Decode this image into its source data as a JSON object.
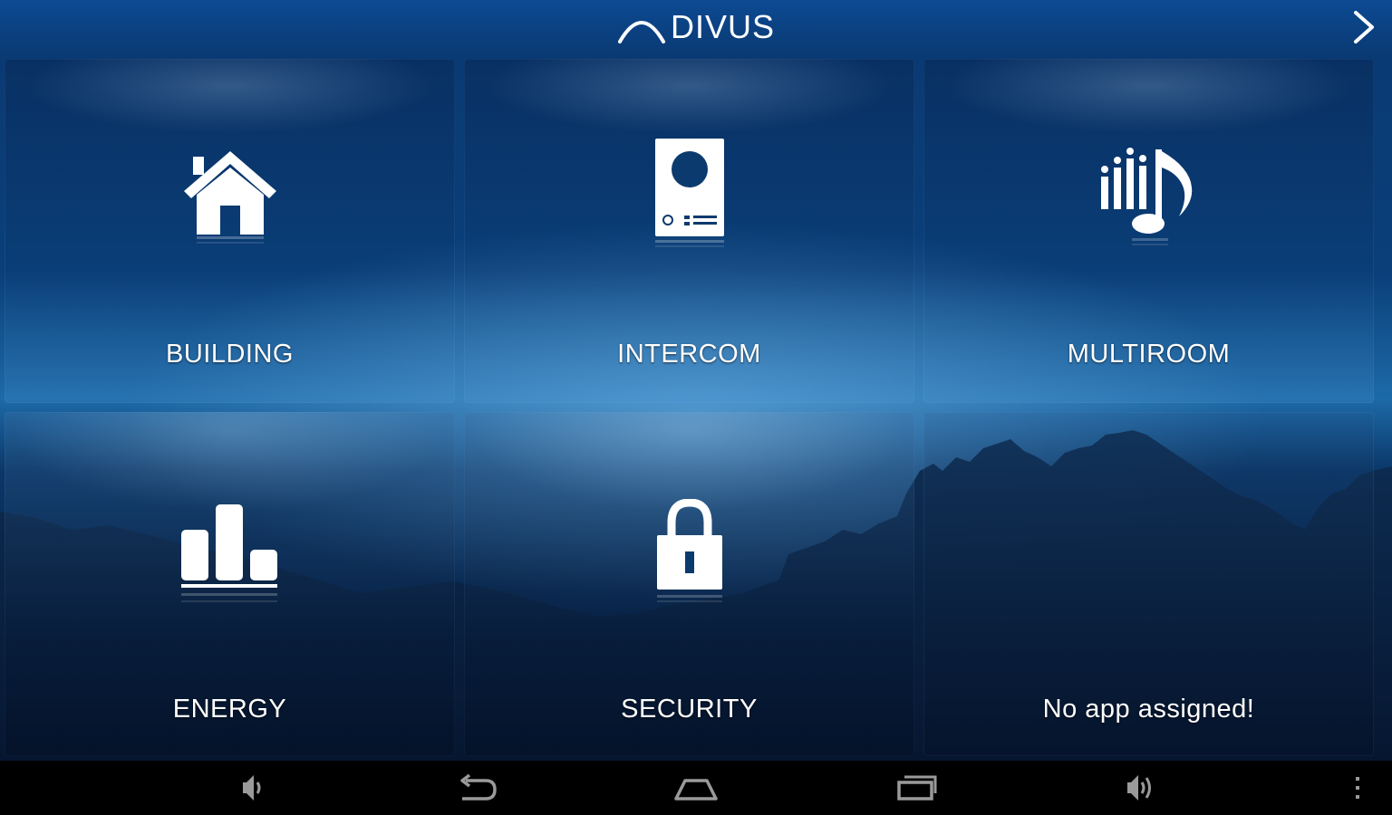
{
  "header": {
    "logo_text": "DIVUS",
    "next_icon": "chevron-right-icon"
  },
  "tiles": [
    {
      "label": "BUILDING",
      "icon": "house-icon"
    },
    {
      "label": "INTERCOM",
      "icon": "intercom-panel-icon"
    },
    {
      "label": "MULTIROOM",
      "icon": "music-note-icon"
    },
    {
      "label": "ENERGY",
      "icon": "bar-chart-icon"
    },
    {
      "label": "SECURITY",
      "icon": "padlock-icon"
    },
    {
      "label": "No app assigned!",
      "icon": ""
    }
  ],
  "navbar": {
    "icons": [
      "volume-down-icon",
      "back-icon",
      "home-icon",
      "recent-apps-icon",
      "volume-up-icon",
      "overflow-menu-icon"
    ]
  },
  "colors": {
    "background_top": "#0c4a93",
    "background_bottom": "#061a36",
    "label": "#ffffff",
    "navbar": "#000000"
  }
}
